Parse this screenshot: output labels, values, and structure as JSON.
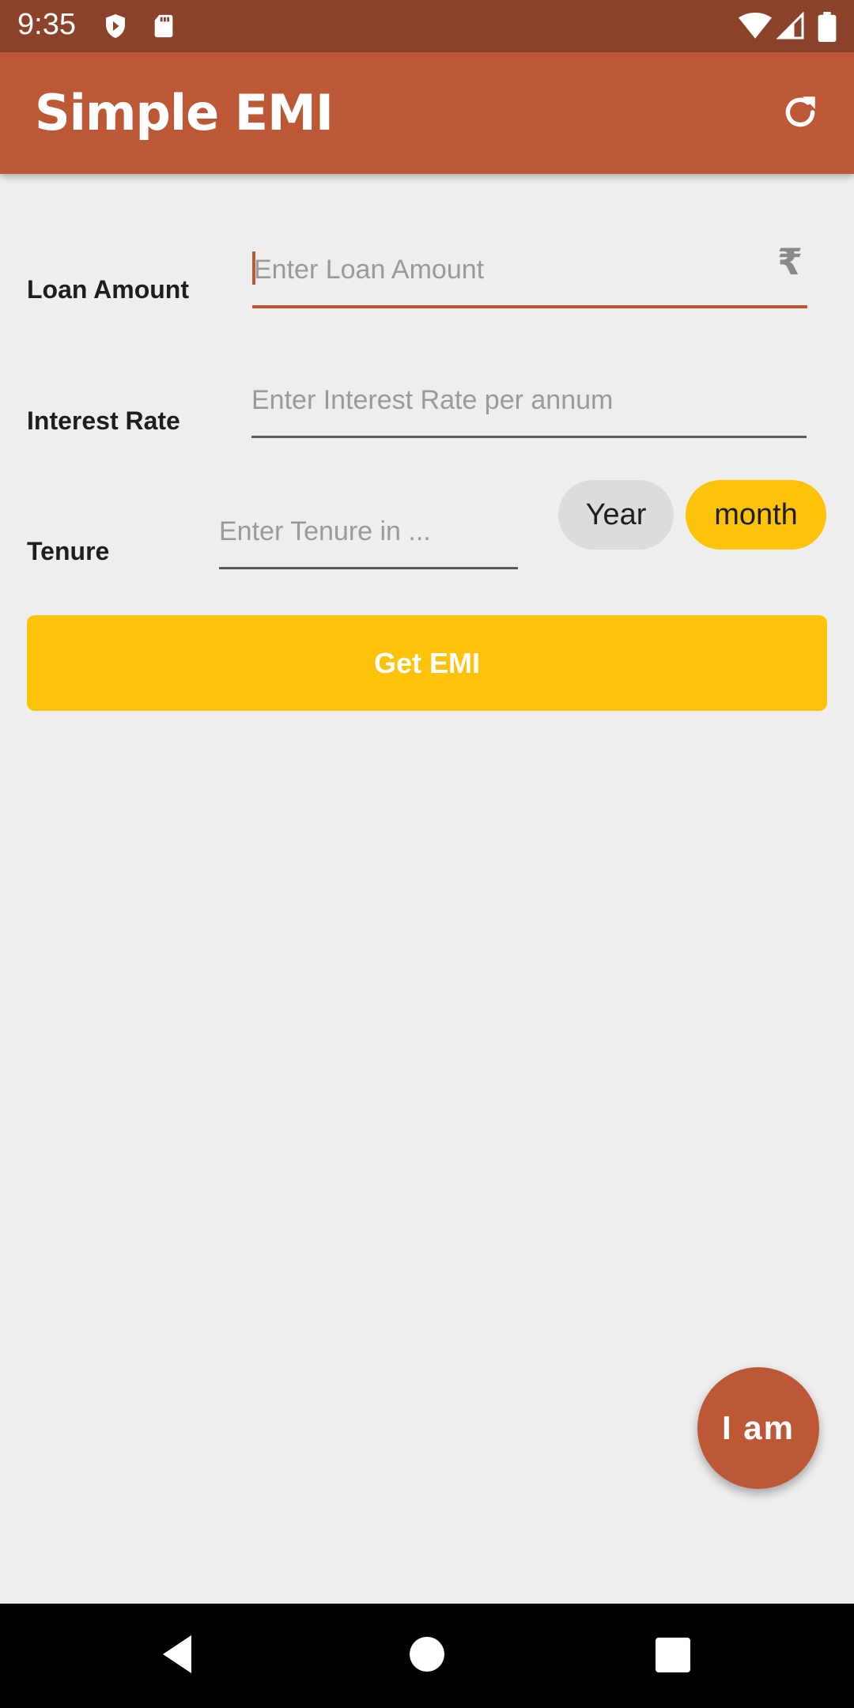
{
  "status_bar": {
    "time": "9:35",
    "icons": [
      "shield-icon",
      "sd-card-icon",
      "wifi-icon",
      "signal-icon",
      "battery-icon"
    ]
  },
  "app_bar": {
    "title": "Simple EMI",
    "action_icon": "refresh-icon"
  },
  "form": {
    "loan_amount": {
      "label": "Loan Amount",
      "placeholder": "Enter Loan Amount",
      "value": "",
      "suffix": "₹"
    },
    "interest_rate": {
      "label": "Interest Rate",
      "placeholder": "Enter Interest Rate per annum",
      "value": ""
    },
    "tenure": {
      "label": "Tenure",
      "placeholder": "Enter Tenure in ...",
      "value": "",
      "options": [
        "Year",
        "month"
      ],
      "selected": "month"
    },
    "submit_label": "Get EMI"
  },
  "fab": {
    "label": "I am"
  },
  "nav_bar": {
    "icons": [
      "back-icon",
      "home-icon",
      "recents-icon"
    ]
  },
  "colors": {
    "status_bar": "#8c412b",
    "primary": "#bd5837",
    "accent": "#fdc20a",
    "background": "#eeeeee"
  }
}
